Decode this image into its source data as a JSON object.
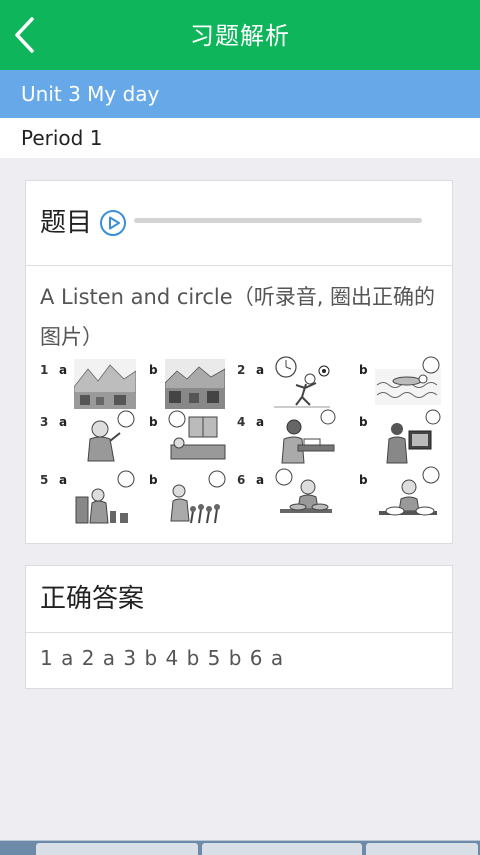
{
  "header": {
    "title": "习题解析"
  },
  "unit": {
    "label": "Unit 3 My day"
  },
  "period": {
    "label": "Period 1"
  },
  "question": {
    "heading": "题目",
    "text": "A Listen and circle（听录音, 圈出正确的图片）",
    "items": [
      {
        "num": "1",
        "a": "a",
        "b": "b"
      },
      {
        "num": "2",
        "a": "a",
        "b": "b"
      },
      {
        "num": "3",
        "a": "a",
        "b": "b"
      },
      {
        "num": "4",
        "a": "a",
        "b": "b"
      },
      {
        "num": "5",
        "a": "a",
        "b": "b"
      },
      {
        "num": "6",
        "a": "a",
        "b": "b"
      }
    ],
    "audio_progress": 0
  },
  "answer": {
    "heading": "正确答案",
    "text": "1 a 2 a 3 b 4 b 5 b 6 a"
  },
  "colors": {
    "header_bg": "#0fb55a",
    "unit_bg": "#67a8e8",
    "play_icon": "#3a8fd8"
  }
}
